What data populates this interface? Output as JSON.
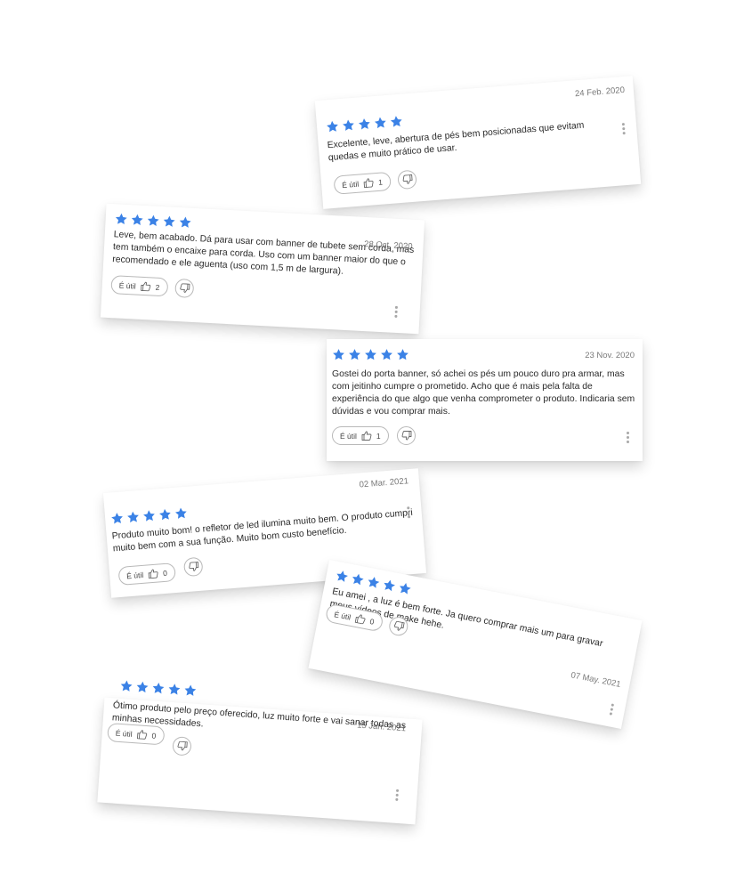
{
  "colors": {
    "star": "#3b82e6",
    "muted_text": "#7a7a7a",
    "border": "#b9b9b9"
  },
  "icons": {
    "star": "star-icon",
    "like": "thumbs-up-icon",
    "dislike": "thumbs-down-icon",
    "more": "more-vertical-icon"
  },
  "reviews": [
    {
      "rating": 5,
      "date": "24 Feb. 2020",
      "text": "Excelente, leve, abertura de pés bem posicionadas que evitam quedas e muito prático de usar.",
      "useful_label": "É útil",
      "useful_count": "1"
    },
    {
      "rating": 5,
      "date": "28 Oct. 2020",
      "text": "Leve, bem acabado. Dá para usar com banner de tubete sem corda, mas tem também o encaixe para corda. Uso com um banner maior do que o recomendado e ele aguenta (uso com 1,5 m de largura).",
      "useful_label": "É útil",
      "useful_count": "2"
    },
    {
      "rating": 5,
      "date": "23 Nov. 2020",
      "text": "Gostei do porta banner, só achei os pés um pouco duro pra armar, mas com jeitinho cumpre o prometido. Acho que é mais pela falta de experiência do que algo que venha comprometer o produto. Indicaria sem dúvidas e vou comprar mais.",
      "useful_label": "É útil",
      "useful_count": "1"
    },
    {
      "rating": 5,
      "date": "02 Mar. 2021",
      "text": "Produto muito bom! o refletor de led ilumina muito bem. O produto cumpri muito bem com a sua função. Muito bom custo benefício.",
      "useful_label": "É útil",
      "useful_count": "0"
    },
    {
      "rating": 5,
      "date": "07 May. 2021",
      "text": "Eu amei , a luz é bem forte. Ja quero comprar mais um para gravar meus vídeos de make hehe.",
      "useful_label": "É útil",
      "useful_count": "0"
    },
    {
      "rating": 5,
      "date": "15 Jan. 2021",
      "text": "Ótimo produto pelo preço oferecido, luz muito forte e vai sanar todas as minhas necessidades.",
      "useful_label": "É útil",
      "useful_count": "0"
    }
  ]
}
